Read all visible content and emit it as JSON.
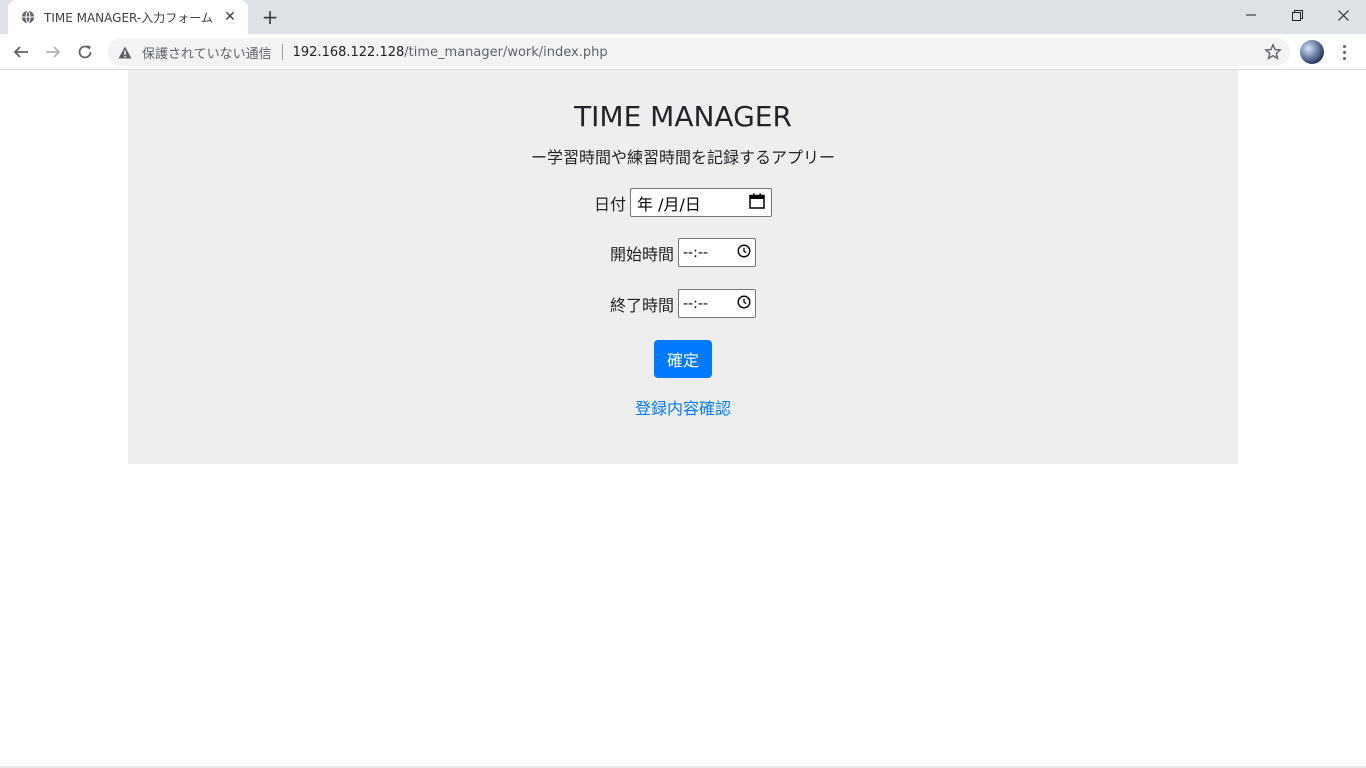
{
  "browser": {
    "tab_title": "TIME MANAGER-入力フォーム",
    "tab_close": "✕",
    "new_tab": "+",
    "security_label": "保護されていない通信",
    "url_host": "192.168.122.128",
    "url_path": "/time_manager/work/index.php"
  },
  "page": {
    "title": "TIME MANAGER",
    "subtitle": "ー学習時間や練習時間を記録するアプリー",
    "date_label": "日付",
    "date_value": "年 /月/日",
    "start_label": "開始時間",
    "start_value": "--:--",
    "end_label": "終了時間",
    "end_value": "--:--",
    "submit_label": "確定",
    "confirm_link": "登録内容確認"
  },
  "colors": {
    "primary": "#007bff",
    "panel": "#eeeeef",
    "text": "#212529"
  }
}
